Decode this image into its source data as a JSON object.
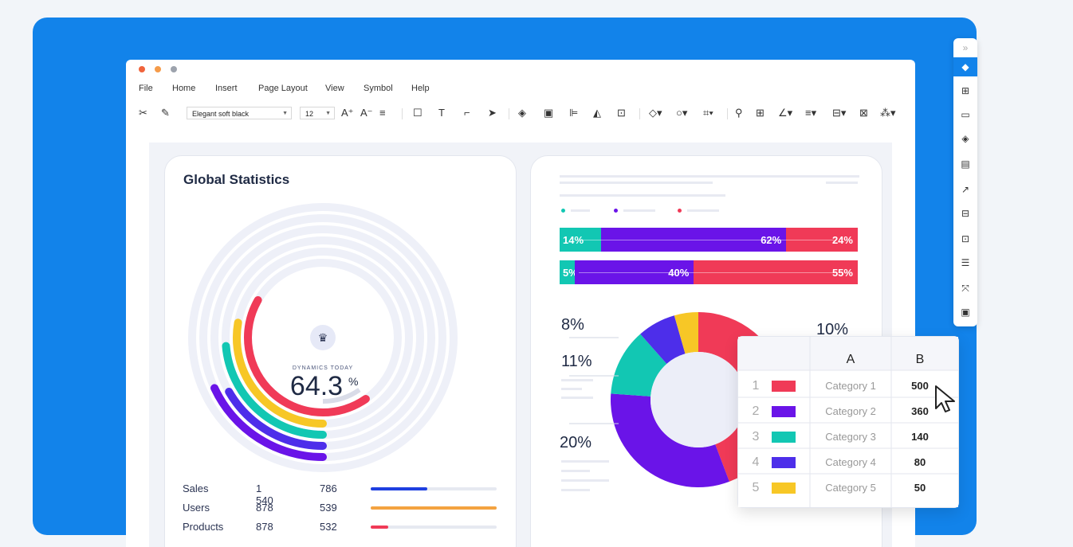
{
  "menu": [
    "File",
    "Home",
    "Insert",
    "Page Layout",
    "View",
    "Symbol",
    "Help"
  ],
  "toolbar": {
    "font": "Elegant soft black",
    "size": "12"
  },
  "card1": {
    "title": "Global Statistics",
    "center_label": "DYNAMICS TODAY",
    "center_value": "64.3",
    "center_unit": "%",
    "stats": [
      {
        "label": "Sales",
        "a": "1 540",
        "b": "786",
        "progress": 0.45,
        "color": "#1e3fe0"
      },
      {
        "label": "Users",
        "a": "878",
        "b": "539",
        "progress": 1.0,
        "color": "#f4a340"
      },
      {
        "label": "Products",
        "a": "878",
        "b": "532",
        "progress": 0.14,
        "color": "#f03a57"
      }
    ]
  },
  "colors": {
    "red": "#f03a57",
    "purple": "#6a14e8",
    "teal": "#12c7b3",
    "blue": "#4d2eea",
    "yellow": "#f7c726"
  },
  "bars": [
    {
      "segments": [
        {
          "label": "14%",
          "value": 14,
          "color": "#12c7b3"
        },
        {
          "label": "62%",
          "value": 62,
          "color": "#6a14e8"
        },
        {
          "label": "24%",
          "value": 24,
          "color": "#f03a57"
        }
      ]
    },
    {
      "segments": [
        {
          "label": "5%",
          "value": 5,
          "color": "#12c7b3"
        },
        {
          "label": "40%",
          "value": 40,
          "color": "#6a14e8"
        },
        {
          "label": "55%",
          "value": 55,
          "color": "#f03a57"
        }
      ]
    }
  ],
  "donut_labels": {
    "l1": "8%",
    "l2": "11%",
    "l3": "20%",
    "r1": "10%"
  },
  "table": {
    "header": [
      "A",
      "B"
    ],
    "rows": [
      {
        "n": "1",
        "color": "#f03a57",
        "cat": "Category 1",
        "val": "500"
      },
      {
        "n": "2",
        "color": "#6a14e8",
        "cat": "Category 2",
        "val": "360"
      },
      {
        "n": "3",
        "color": "#12c7b3",
        "cat": "Category 3",
        "val": "140"
      },
      {
        "n": "4",
        "color": "#4d2eea",
        "cat": "Category 4",
        "val": "80"
      },
      {
        "n": "5",
        "color": "#f7c726",
        "cat": "Category 5",
        "val": "50"
      }
    ]
  },
  "rail_icons": [
    "double-chevron-icon",
    "fill-icon",
    "grid-icon",
    "image-icon",
    "layers-icon",
    "page-icon",
    "chart-icon",
    "table-icon",
    "shape-icon",
    "align-icon",
    "fit-icon",
    "present-icon"
  ]
}
